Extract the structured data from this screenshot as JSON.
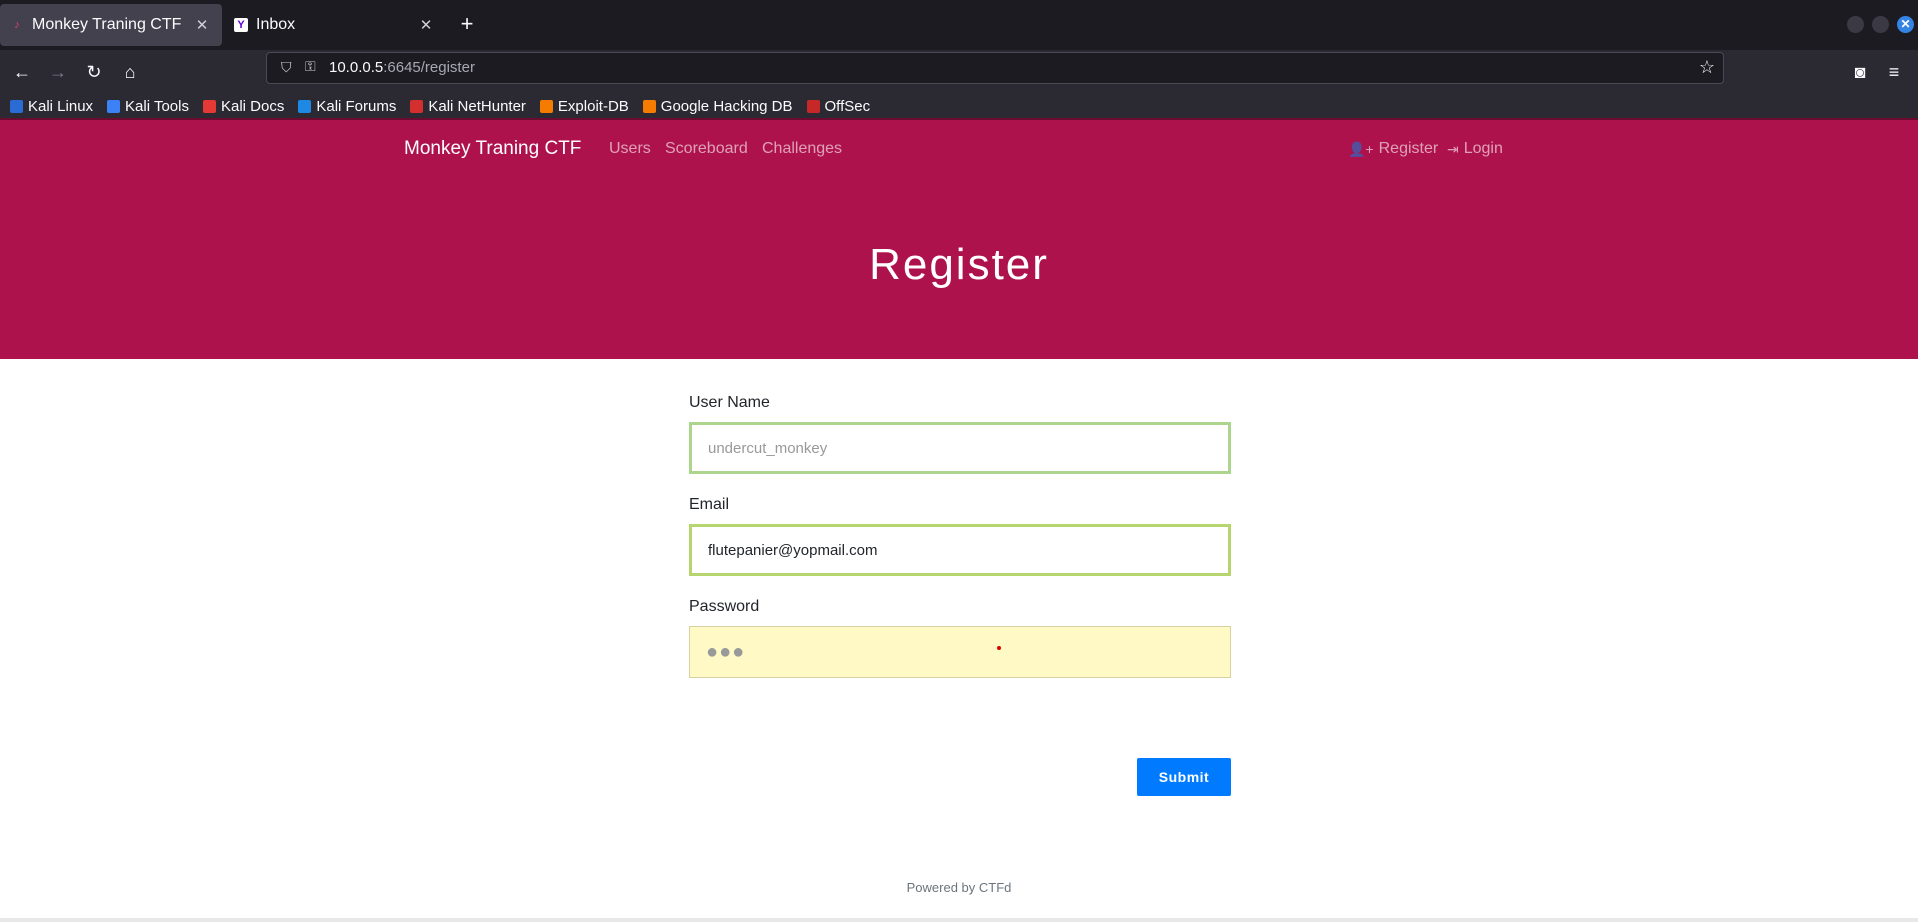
{
  "browser": {
    "tabs": [
      {
        "title": "Monkey Traning CTF",
        "active": true,
        "icon": "ctfd-favicon-icon"
      },
      {
        "title": "Inbox",
        "active": false,
        "icon": "yahoo-favicon-icon"
      }
    ],
    "url_host": "10.0.0.5",
    "url_path": ":6645/register",
    "bookmarks": [
      {
        "label": "Kali Linux",
        "icon": "kali-dragon-icon",
        "color": "#2a6bd6"
      },
      {
        "label": "Kali Tools",
        "icon": "kali-tools-icon",
        "color": "#3b82f6"
      },
      {
        "label": "Kali Docs",
        "icon": "kali-docs-icon",
        "color": "#e53935"
      },
      {
        "label": "Kali Forums",
        "icon": "kali-forums-icon",
        "color": "#1e88e5"
      },
      {
        "label": "Kali NetHunter",
        "icon": "nethunter-icon",
        "color": "#d32f2f"
      },
      {
        "label": "Exploit-DB",
        "icon": "exploitdb-icon",
        "color": "#f57c00"
      },
      {
        "label": "Google Hacking DB",
        "icon": "ghdb-icon",
        "color": "#f57c00"
      },
      {
        "label": "OffSec",
        "icon": "offsec-icon",
        "color": "#c62828"
      }
    ]
  },
  "site": {
    "brand": "Monkey Traning CTF",
    "nav": [
      "Users",
      "Scoreboard",
      "Challenges"
    ],
    "nav_right": {
      "register": "Register",
      "login": "Login"
    },
    "hero_title": "Register",
    "accent_color": "#ae124d"
  },
  "form": {
    "username_label": "User Name",
    "username_placeholder": "undercut_monkey",
    "email_label": "Email",
    "email_value": "flutepanier@yopmail.com",
    "password_label": "Password",
    "password_mask": "●●●",
    "submit_label": "Submit"
  },
  "footer": "Powered by CTFd"
}
